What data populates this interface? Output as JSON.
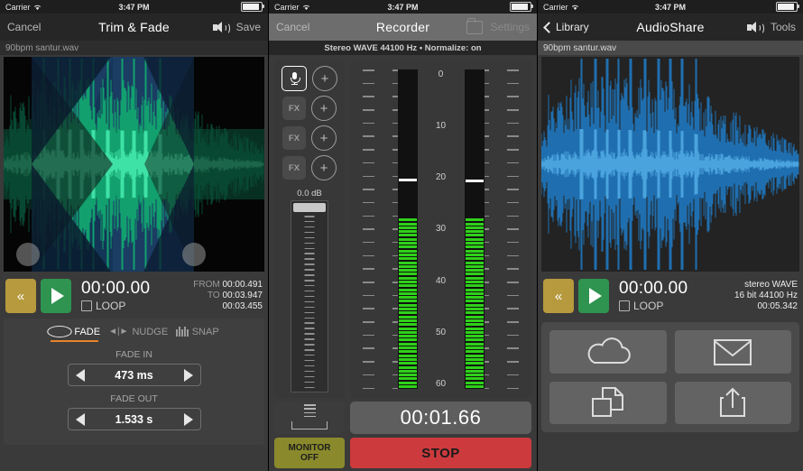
{
  "statusbar": {
    "carrier": "Carrier",
    "time": "3:47 PM"
  },
  "panels": [
    {
      "id": "trim-fade",
      "nav": {
        "left": "Cancel",
        "title": "Trim & Fade",
        "right": "Save",
        "speaker_icon": "speaker-icon"
      },
      "filename": "90bpm santur.wav",
      "transport": {
        "rewind_icon": "rewind-icon",
        "play_icon": "play-icon",
        "time": "00:00.00",
        "loop_label": "LOOP",
        "from_label": "FROM",
        "from_value": "00:00.491",
        "to_label": "TO",
        "to_value": "00:03.947",
        "duration": "00:03.455"
      },
      "tools": [
        {
          "label": "FADE",
          "icon": "lens-icon",
          "active": true
        },
        {
          "label": "NUDGE",
          "icon": "nudge-icon",
          "active": false
        },
        {
          "label": "SNAP",
          "icon": "snap-icon",
          "active": false
        }
      ],
      "fade_in": {
        "label": "FADE IN",
        "value": "473 ms"
      },
      "fade_out": {
        "label": "FADE OUT",
        "value": "1.533 s"
      }
    },
    {
      "id": "recorder",
      "nav": {
        "left": "Cancel",
        "title": "Recorder",
        "right": "Settings",
        "folder_icon": "folder-icon"
      },
      "format_line": "Stereo WAVE 44100 Hz • Normalize: on",
      "channel": {
        "mic_icon": "microphone-icon",
        "fx_slots": [
          "FX",
          "FX",
          "FX"
        ],
        "add_label": "+",
        "gain_label": "0.0 dB"
      },
      "meter": {
        "ticks": [
          "0",
          "10",
          "20",
          "30",
          "40",
          "50",
          "60"
        ],
        "unit": "dB"
      },
      "rec_time": "00:01.66",
      "monitor": {
        "line1": "MONITOR",
        "line2": "OFF"
      },
      "stop_label": "STOP",
      "level_icon": "level-icon"
    },
    {
      "id": "audioshare",
      "nav": {
        "left": "Library",
        "title": "AudioShare",
        "right": "Tools",
        "speaker_icon": "speaker-icon",
        "back_icon": "chevron-left-icon"
      },
      "filename": "90bpm santur.wav",
      "transport": {
        "rewind_icon": "rewind-icon",
        "play_icon": "play-icon",
        "time": "00:00.00",
        "loop_label": "LOOP",
        "info1": "stereo WAVE",
        "info2": "16 bit 44100 Hz",
        "info3": "00:05.342"
      },
      "share_buttons": [
        {
          "name": "cloud-icon"
        },
        {
          "name": "envelope-icon"
        },
        {
          "name": "copy-icon"
        },
        {
          "name": "share-icon"
        }
      ]
    }
  ],
  "colors": {
    "accent_orange": "#e8832a",
    "play_green": "#2f9450",
    "rewind_gold": "#b79a3e",
    "stop_red": "#cc3a3d",
    "monitor_olive": "#8a8a2c",
    "meter_green": "#2fd11a",
    "waveform_green": "#18b07a",
    "waveform_blue": "#1f6fb0",
    "selection_blue": "#1b3c63"
  }
}
